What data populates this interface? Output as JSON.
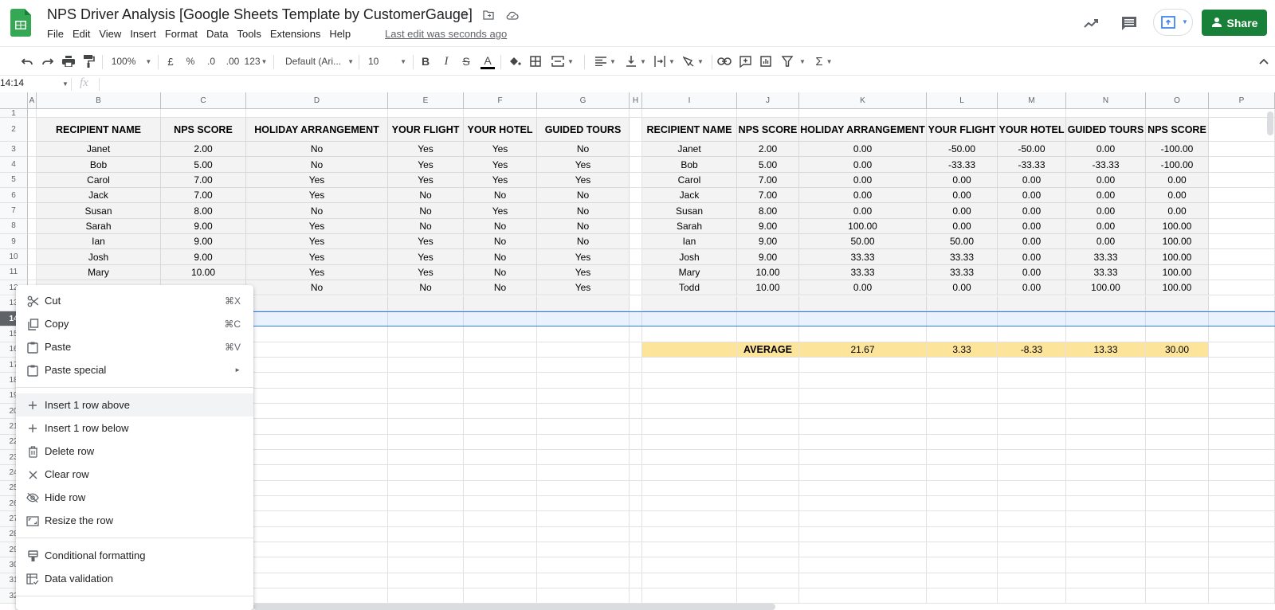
{
  "app": {
    "doc_title": "NPS Driver Analysis [Google Sheets Template by CustomerGauge]",
    "last_edit": "Last edit was seconds ago",
    "share_label": "Share",
    "brand_color": "#188038"
  },
  "menu_bar": [
    "File",
    "Edit",
    "View",
    "Insert",
    "Format",
    "Data",
    "Tools",
    "Extensions",
    "Help"
  ],
  "toolbar": {
    "zoom": "100%",
    "currency": "£",
    "percent": "%",
    "decrease_decimals": ".0",
    "increase_decimals": ".00",
    "more_formats": "123",
    "font": "Default (Ari...",
    "font_size": "10"
  },
  "formula_bar": {
    "name_box": "14:14",
    "fx": "fx",
    "value": ""
  },
  "columns": [
    "A",
    "B",
    "C",
    "D",
    "E",
    "F",
    "G",
    "H",
    "I",
    "J",
    "K",
    "L",
    "M",
    "N",
    "O",
    "P"
  ],
  "rows": [
    "1",
    "2",
    "3",
    "4",
    "5",
    "6",
    "7",
    "8",
    "9",
    "10",
    "11",
    "12",
    "13",
    "14",
    "15",
    "16",
    "17",
    "18",
    "19",
    "20",
    "21",
    "22",
    "23",
    "24",
    "25",
    "26",
    "27",
    "28",
    "29",
    "30",
    "31",
    "32"
  ],
  "selected_row": "14",
  "left_table": {
    "headers": [
      "RECIPIENT NAME",
      "NPS SCORE",
      "HOLIDAY ARRANGEMENT",
      "YOUR FLIGHT",
      "YOUR HOTEL",
      "GUIDED TOURS"
    ],
    "rows": [
      [
        "Janet",
        "2.00",
        "No",
        "Yes",
        "Yes",
        "No"
      ],
      [
        "Bob",
        "5.00",
        "No",
        "Yes",
        "Yes",
        "Yes"
      ],
      [
        "Carol",
        "7.00",
        "Yes",
        "Yes",
        "Yes",
        "Yes"
      ],
      [
        "Jack",
        "7.00",
        "Yes",
        "No",
        "No",
        "No"
      ],
      [
        "Susan",
        "8.00",
        "No",
        "No",
        "Yes",
        "No"
      ],
      [
        "Sarah",
        "9.00",
        "Yes",
        "No",
        "No",
        "No"
      ],
      [
        "Ian",
        "9.00",
        "Yes",
        "Yes",
        "No",
        "No"
      ],
      [
        "Josh",
        "9.00",
        "Yes",
        "Yes",
        "No",
        "Yes"
      ],
      [
        "Mary",
        "10.00",
        "Yes",
        "Yes",
        "No",
        "Yes"
      ],
      [
        "",
        "",
        "No",
        "No",
        "No",
        "Yes"
      ]
    ]
  },
  "right_table": {
    "headers": [
      "RECIPIENT NAME",
      "NPS SCORE",
      "HOLIDAY ARRANGEMENT",
      "YOUR FLIGHT",
      "YOUR HOTEL",
      "GUIDED TOURS",
      "NPS SCORE"
    ],
    "rows": [
      [
        "Janet",
        "2.00",
        "0.00",
        "-50.00",
        "-50.00",
        "0.00",
        "-100.00"
      ],
      [
        "Bob",
        "5.00",
        "0.00",
        "-33.33",
        "-33.33",
        "-33.33",
        "-100.00"
      ],
      [
        "Carol",
        "7.00",
        "0.00",
        "0.00",
        "0.00",
        "0.00",
        "0.00"
      ],
      [
        "Jack",
        "7.00",
        "0.00",
        "0.00",
        "0.00",
        "0.00",
        "0.00"
      ],
      [
        "Susan",
        "8.00",
        "0.00",
        "0.00",
        "0.00",
        "0.00",
        "0.00"
      ],
      [
        "Sarah",
        "9.00",
        "100.00",
        "0.00",
        "0.00",
        "0.00",
        "100.00"
      ],
      [
        "Ian",
        "9.00",
        "50.00",
        "50.00",
        "0.00",
        "0.00",
        "100.00"
      ],
      [
        "Josh",
        "9.00",
        "33.33",
        "33.33",
        "0.00",
        "33.33",
        "100.00"
      ],
      [
        "Mary",
        "10.00",
        "33.33",
        "33.33",
        "0.00",
        "33.33",
        "100.00"
      ],
      [
        "Todd",
        "10.00",
        "0.00",
        "0.00",
        "0.00",
        "100.00",
        "100.00"
      ]
    ],
    "average_label": "AVERAGE",
    "averages": [
      "21.67",
      "3.33",
      "-8.33",
      "13.33",
      "30.00"
    ]
  },
  "context_menu": {
    "items": [
      {
        "label": "Cut",
        "shortcut": "⌘X",
        "icon": "scissors-icon"
      },
      {
        "label": "Copy",
        "shortcut": "⌘C",
        "icon": "copy-icon"
      },
      {
        "label": "Paste",
        "shortcut": "⌘V",
        "icon": "clipboard-icon"
      },
      {
        "label": "Paste special",
        "shortcut": "►",
        "icon": "clipboard-icon"
      },
      {
        "label": "Insert 1 row above",
        "icon": "plus-icon"
      },
      {
        "label": "Insert 1 row below",
        "icon": "plus-icon"
      },
      {
        "label": "Delete row",
        "icon": "trash-icon"
      },
      {
        "label": "Clear row",
        "icon": "close-icon"
      },
      {
        "label": "Hide row",
        "icon": "eye-off-icon"
      },
      {
        "label": "Resize the row",
        "icon": "resize-icon"
      },
      {
        "label": "Conditional formatting",
        "icon": "paint-roller-icon"
      },
      {
        "label": "Data validation",
        "icon": "data-validation-icon"
      }
    ]
  }
}
